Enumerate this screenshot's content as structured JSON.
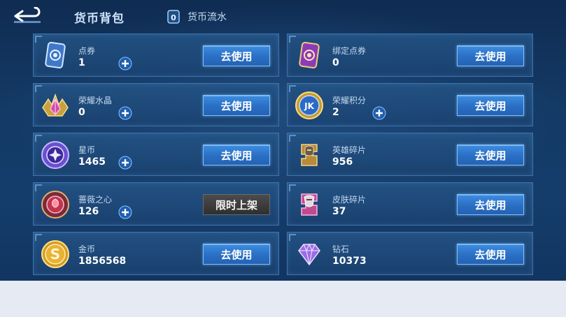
{
  "header": {
    "title": "货币背包",
    "flow_link": "货币流水"
  },
  "currencies": [
    {
      "id": "voucher",
      "name": "点券",
      "amount": "1",
      "has_plus": true,
      "action": "去使用",
      "icon": "voucher-card-icon"
    },
    {
      "id": "bound_voucher",
      "name": "绑定点券",
      "amount": "0",
      "has_plus": false,
      "action": "去使用",
      "icon": "bound-voucher-card-icon"
    },
    {
      "id": "glory_crystal",
      "name": "荣耀水晶",
      "amount": "0",
      "has_plus": true,
      "action": "去使用",
      "icon": "glory-crystal-icon"
    },
    {
      "id": "glory_points",
      "name": "荣耀积分",
      "amount": "2",
      "has_plus": true,
      "action": "去使用",
      "icon": "glory-points-coin-icon"
    },
    {
      "id": "star_coin",
      "name": "星币",
      "amount": "1465",
      "has_plus": true,
      "action": "去使用",
      "icon": "star-coin-icon"
    },
    {
      "id": "hero_fragment",
      "name": "英雄碎片",
      "amount": "956",
      "has_plus": false,
      "action": "去使用",
      "icon": "hero-fragment-icon"
    },
    {
      "id": "rose_heart",
      "name": "蔷薇之心",
      "amount": "126",
      "has_plus": true,
      "action": "限时上架",
      "icon": "rose-heart-icon"
    },
    {
      "id": "skin_fragment",
      "name": "皮肤碎片",
      "amount": "37",
      "has_plus": false,
      "action": "去使用",
      "icon": "skin-fragment-icon"
    },
    {
      "id": "gold",
      "name": "金币",
      "amount": "1856568",
      "has_plus": false,
      "action": "去使用",
      "icon": "gold-coin-icon"
    },
    {
      "id": "diamond",
      "name": "钻石",
      "amount": "10373",
      "has_plus": false,
      "action": "去使用",
      "icon": "diamond-icon"
    }
  ],
  "colors": {
    "background": "#143a66",
    "card_border": "#3f74ab",
    "button_blue": "#2a6fc4",
    "button_gray": "#2f2f2f"
  }
}
